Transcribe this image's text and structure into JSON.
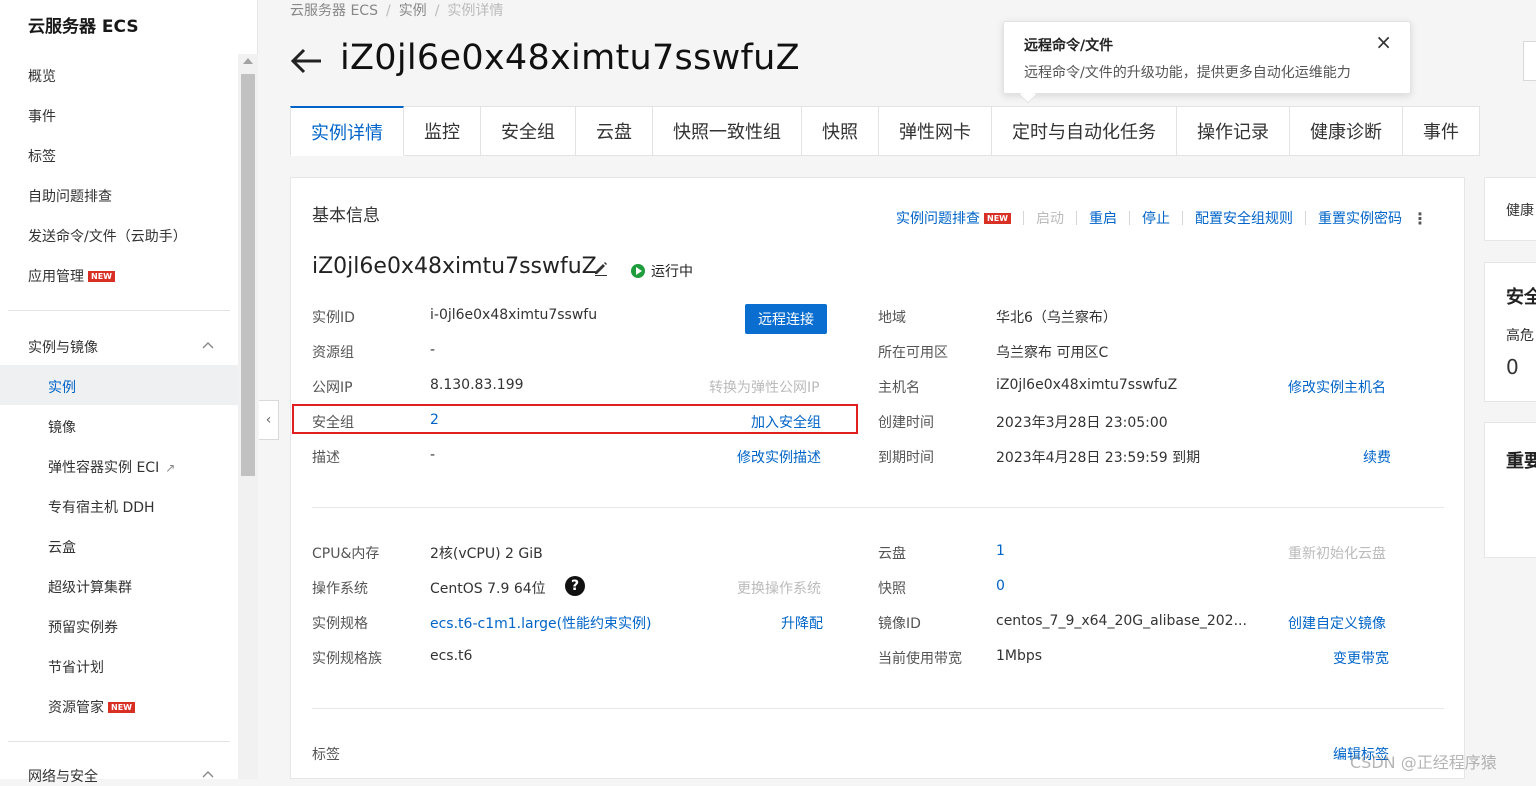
{
  "sidebar": {
    "title": "云服务器 ECS",
    "items": [
      {
        "label": "概览"
      },
      {
        "label": "事件"
      },
      {
        "label": "标签"
      },
      {
        "label": "自助问题排查"
      },
      {
        "label": "发送命令/文件（云助手）"
      },
      {
        "label": "应用管理",
        "badge": "NEW"
      }
    ],
    "section_instances": {
      "label": "实例与镜像",
      "items": [
        {
          "label": "实例",
          "active": true
        },
        {
          "label": "镜像"
        },
        {
          "label": "弹性容器实例 ECI",
          "external": true
        },
        {
          "label": "专有宿主机 DDH"
        },
        {
          "label": "云盒"
        },
        {
          "label": "超级计算集群"
        },
        {
          "label": "预留实例券"
        },
        {
          "label": "节省计划"
        },
        {
          "label": "资源管家",
          "badge": "NEW"
        }
      ]
    },
    "section_network": {
      "label": "网络与安全"
    }
  },
  "breadcrumb": [
    "云服务器 ECS",
    "实例",
    "实例详情"
  ],
  "page_title": "iZ0jl6e0x48ximtu7sswfuZ",
  "tooltip": {
    "title": "远程命令/文件",
    "text": "远程命令/文件的升级功能，提供更多自动化运维能力",
    "close": "×"
  },
  "tabs": [
    {
      "label": "实例详情",
      "active": true
    },
    {
      "label": "监控"
    },
    {
      "label": "安全组"
    },
    {
      "label": "云盘"
    },
    {
      "label": "快照一致性组"
    },
    {
      "label": "快照"
    },
    {
      "label": "弹性网卡"
    },
    {
      "label": "定时与自动化任务"
    },
    {
      "label": "操作记录"
    },
    {
      "label": "健康诊断"
    },
    {
      "label": "事件"
    }
  ],
  "basic_info": {
    "title": "基本信息",
    "actions": {
      "troubleshoot": "实例问题排查",
      "troubleshoot_badge": "NEW",
      "start": "启动",
      "restart": "重启",
      "stop": "停止",
      "config_sg": "配置安全组规则",
      "reset_pwd": "重置实例密码"
    },
    "instance_name": "iZ0jl6e0x48ximtu7sswfuZ",
    "status": "运行中",
    "remote_connect": "远程连接",
    "left_rows": [
      {
        "label": "实例ID",
        "value": "i-0jl6e0x48ximtu7sswfu"
      },
      {
        "label": "资源组",
        "value": "-"
      },
      {
        "label": "公网IP",
        "value": "8.130.83.199",
        "action": "转换为弹性公网IP"
      },
      {
        "label": "安全组",
        "value": "2",
        "action": "加入安全组"
      },
      {
        "label": "描述",
        "value": "-",
        "action": "修改实例描述"
      }
    ],
    "right_rows": [
      {
        "label": "地域",
        "value": "华北6（乌兰察布）"
      },
      {
        "label": "所在可用区",
        "value": "乌兰察布 可用区C"
      },
      {
        "label": "主机名",
        "value": "iZ0jl6e0x48ximtu7sswfuZ",
        "action": "修改实例主机名"
      },
      {
        "label": "创建时间",
        "value": "2023年3月28日 23:05:00"
      },
      {
        "label": "到期时间",
        "value": "2023年4月28日 23:59:59 到期",
        "action": "续费"
      }
    ],
    "left_rows2": [
      {
        "label": "CPU&内存",
        "value": "2核(vCPU) 2 GiB"
      },
      {
        "label": "操作系统",
        "value": "CentOS 7.9 64位",
        "action": "更换操作系统"
      },
      {
        "label": "实例规格",
        "value": "ecs.t6-c1m1.large(性能约束实例)",
        "action": "升降配"
      },
      {
        "label": "实例规格族",
        "value": "ecs.t6"
      }
    ],
    "right_rows2": [
      {
        "label": "云盘",
        "value": "1",
        "action": "重新初始化云盘"
      },
      {
        "label": "快照",
        "value": "0"
      },
      {
        "label": "镜像ID",
        "value": "centos_7_9_x64_20G_alibase_202...",
        "action": "创建自定义镜像"
      },
      {
        "label": "当前使用带宽",
        "value": "1Mbps",
        "action": "变更带宽"
      }
    ],
    "tags_label": "标签",
    "tags_action": "编辑标签"
  },
  "right_panel": {
    "health_label": "健康",
    "security_title": "安全",
    "security_sub": "高危",
    "security_count": "0",
    "important_title": "重要"
  },
  "watermark": "CSDN @正经程序猿"
}
